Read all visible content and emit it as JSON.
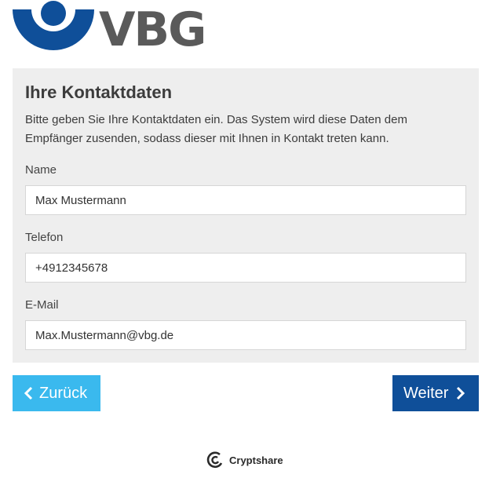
{
  "header": {
    "brand": "VBG",
    "brand_color": "#0f4f99",
    "text_color": "#5a5a5a"
  },
  "form": {
    "title": "Ihre Kontaktdaten",
    "description": "Bitte geben Sie Ihre Kontaktdaten ein. Das System wird diese Daten dem Empfänger zusenden, sodass dieser mit Ihnen in Kontakt treten kann.",
    "fields": [
      {
        "label": "Name",
        "value": "Max Mustermann"
      },
      {
        "label": "Telefon",
        "value": "+4912345678"
      },
      {
        "label": "E-Mail",
        "value": "Max.Mustermann@vbg.de"
      }
    ]
  },
  "nav": {
    "back_label": "Zurück",
    "back_icon": "chevron-left-icon",
    "back_color": "#3ab9ee",
    "next_label": "Weiter",
    "next_icon": "chevron-right-icon",
    "next_color": "#0f4f99"
  },
  "footer": {
    "brand": "Cryptshare",
    "icon": "cryptshare-logo-icon"
  }
}
